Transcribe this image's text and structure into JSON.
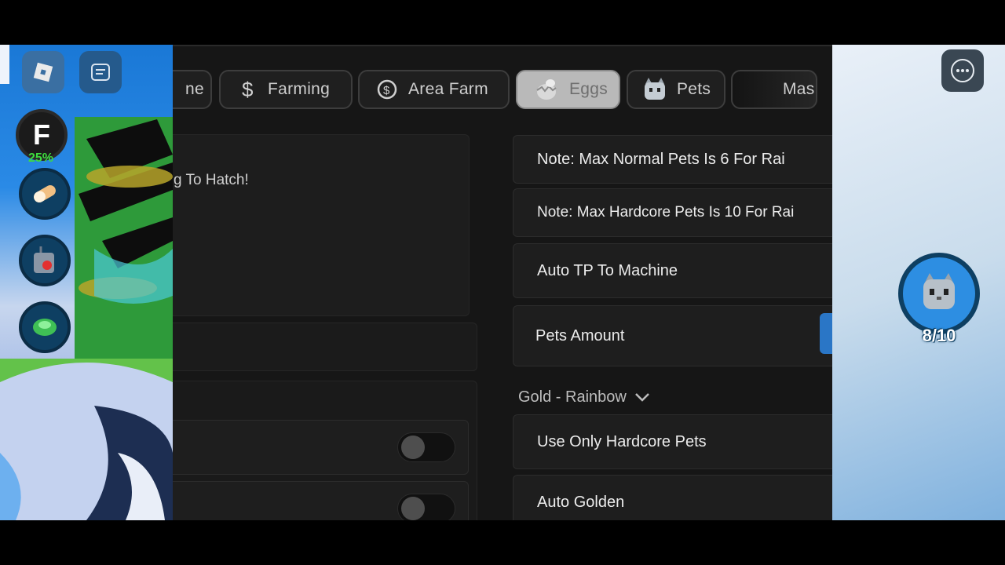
{
  "tabs": [
    {
      "label": "ne",
      "icon": "none"
    },
    {
      "label": "Farming",
      "icon": "dollar-icon"
    },
    {
      "label": "Area Farm",
      "icon": "coin-icon"
    },
    {
      "label": "Eggs",
      "icon": "egg-icon",
      "active": true
    },
    {
      "label": "Pets",
      "icon": "cat-icon"
    },
    {
      "label": "Mas",
      "icon": "none"
    }
  ],
  "left_panel": {
    "hatch_text": "g To Hatch!"
  },
  "right_panel": {
    "note_normal": "Note: Max Normal Pets Is 6 For Rai",
    "note_hardcore": "Note: Max Hardcore Pets Is 10 For Rai",
    "auto_tp": "Auto TP To Machine",
    "pets_amount": "Pets Amount",
    "section_title": "Gold - Rainbow",
    "use_hardcore": "Use Only Hardcore Pets",
    "auto_golden": "Auto Golden"
  },
  "hud": {
    "pet_count": "8/10",
    "percent": "25%"
  },
  "colors": {
    "accent_blue": "#2a8ae6",
    "window_bg": "#161616"
  }
}
